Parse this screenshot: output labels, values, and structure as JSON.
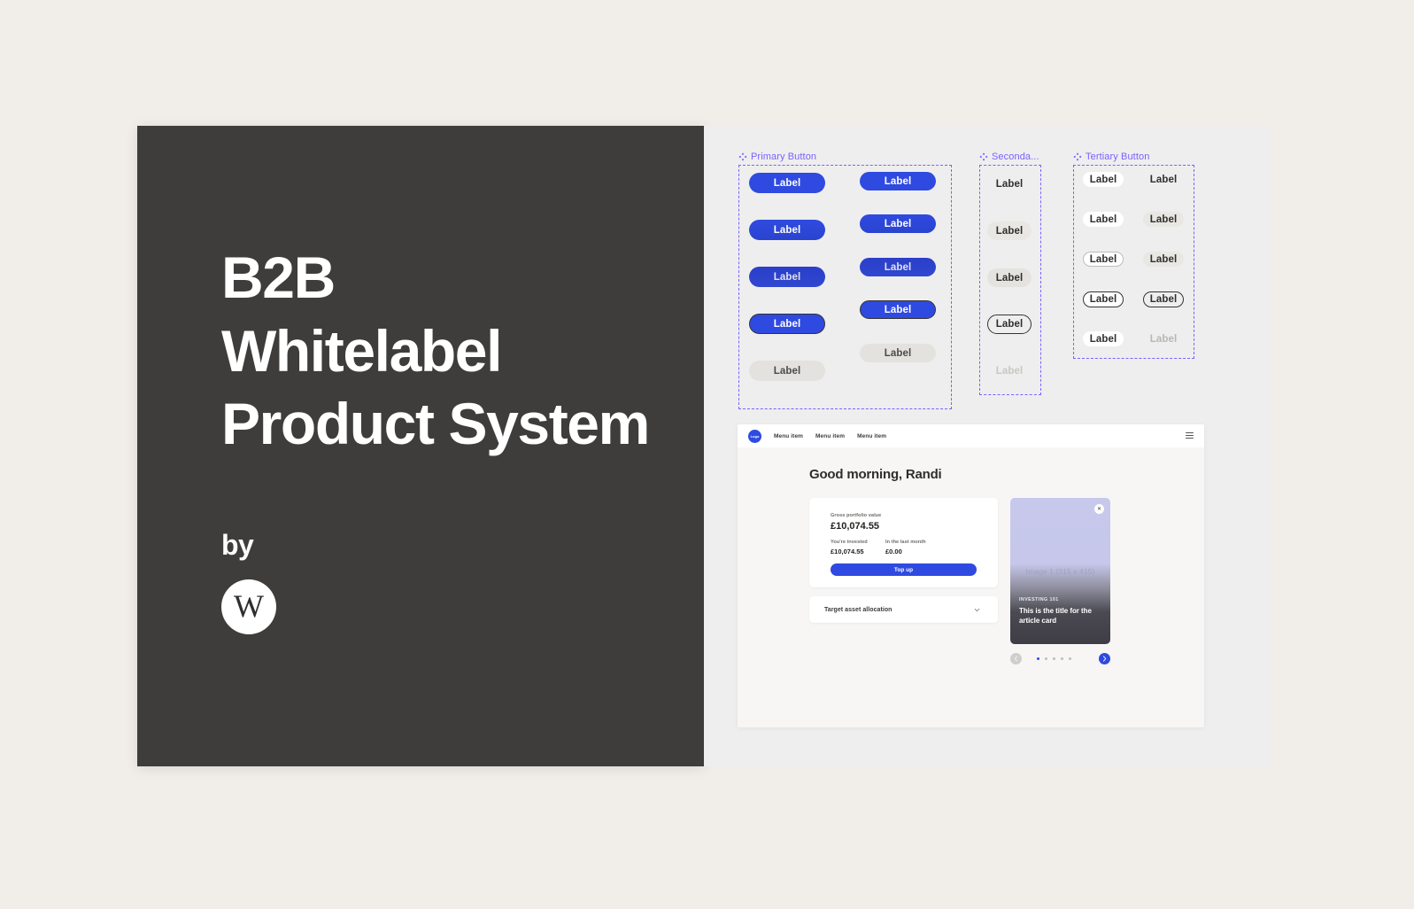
{
  "hero": {
    "title_lines": [
      "B2B",
      "Whitelabel",
      "Product System"
    ],
    "by_label": "by",
    "logo_glyph": "W",
    "background_color": "#3e3d3b",
    "text_color": "#ffffff"
  },
  "page": {
    "background_color": "#f1ede9",
    "canvas_color": "#eeeeee",
    "accent_color": "#2f4ae0",
    "frame_color": "#7b61ff"
  },
  "sections": [
    {
      "label": "Primary Button",
      "icon": "figma-component-icon",
      "columns": [
        {
          "states": [
            "Label",
            "Label",
            "Label",
            "Label",
            "Label"
          ]
        },
        {
          "states": [
            "Label",
            "Label",
            "Label",
            "Label",
            "Label"
          ]
        }
      ]
    },
    {
      "label": "Seconda...",
      "icon": "figma-component-icon",
      "columns": [
        {
          "states": [
            "Label",
            "Label",
            "Label",
            "Label",
            "Label"
          ]
        }
      ]
    },
    {
      "label": "Tertiary Button",
      "icon": "figma-component-icon",
      "columns": [
        {
          "states": [
            "Label",
            "Label",
            "Label",
            "Label",
            "Label"
          ]
        },
        {
          "states": [
            "Label",
            "Label",
            "Label",
            "Label",
            "Label"
          ]
        }
      ]
    }
  ],
  "primary_buttons": {
    "col_a": [
      "Label",
      "Label",
      "Label",
      "Label",
      "Label"
    ],
    "col_b": [
      "Label",
      "Label",
      "Label",
      "Label",
      "Label"
    ]
  },
  "secondary_buttons": [
    "Label",
    "Label",
    "Label",
    "Label",
    "Label"
  ],
  "tertiary_buttons": {
    "col_a": [
      "Label",
      "Label",
      "Label",
      "Label",
      "Label"
    ],
    "col_b": [
      "Label",
      "Label",
      "Label",
      "Label",
      "Label"
    ]
  },
  "app": {
    "nav": {
      "logo_label": "Logo",
      "menu_items": [
        "Menu item",
        "Menu item",
        "Menu item"
      ],
      "menu_icon": "hamburger-icon"
    },
    "greeting": "Good morning, Randi",
    "portfolio_card": {
      "gross_label": "Gross portfolio value",
      "gross_value": "£10,074.55",
      "invested_label": "You're invested",
      "invested_value": "£10,074.55",
      "month_label": "In the last month",
      "month_value": "£0.00",
      "cta_label": "Top up"
    },
    "allocation_card": {
      "label": "Target asset allocation",
      "icon": "chevron-down-icon"
    },
    "article_card": {
      "close_icon": "close-icon",
      "image_placeholder": "Image 1 (315 x 415)",
      "kicker": "INVESTING 101",
      "title": "This is the title for the article card"
    },
    "carousel": {
      "prev_icon": "chevron-left-icon",
      "next_icon": "chevron-right-icon",
      "dot_count": 5,
      "active_dot": 1
    }
  }
}
